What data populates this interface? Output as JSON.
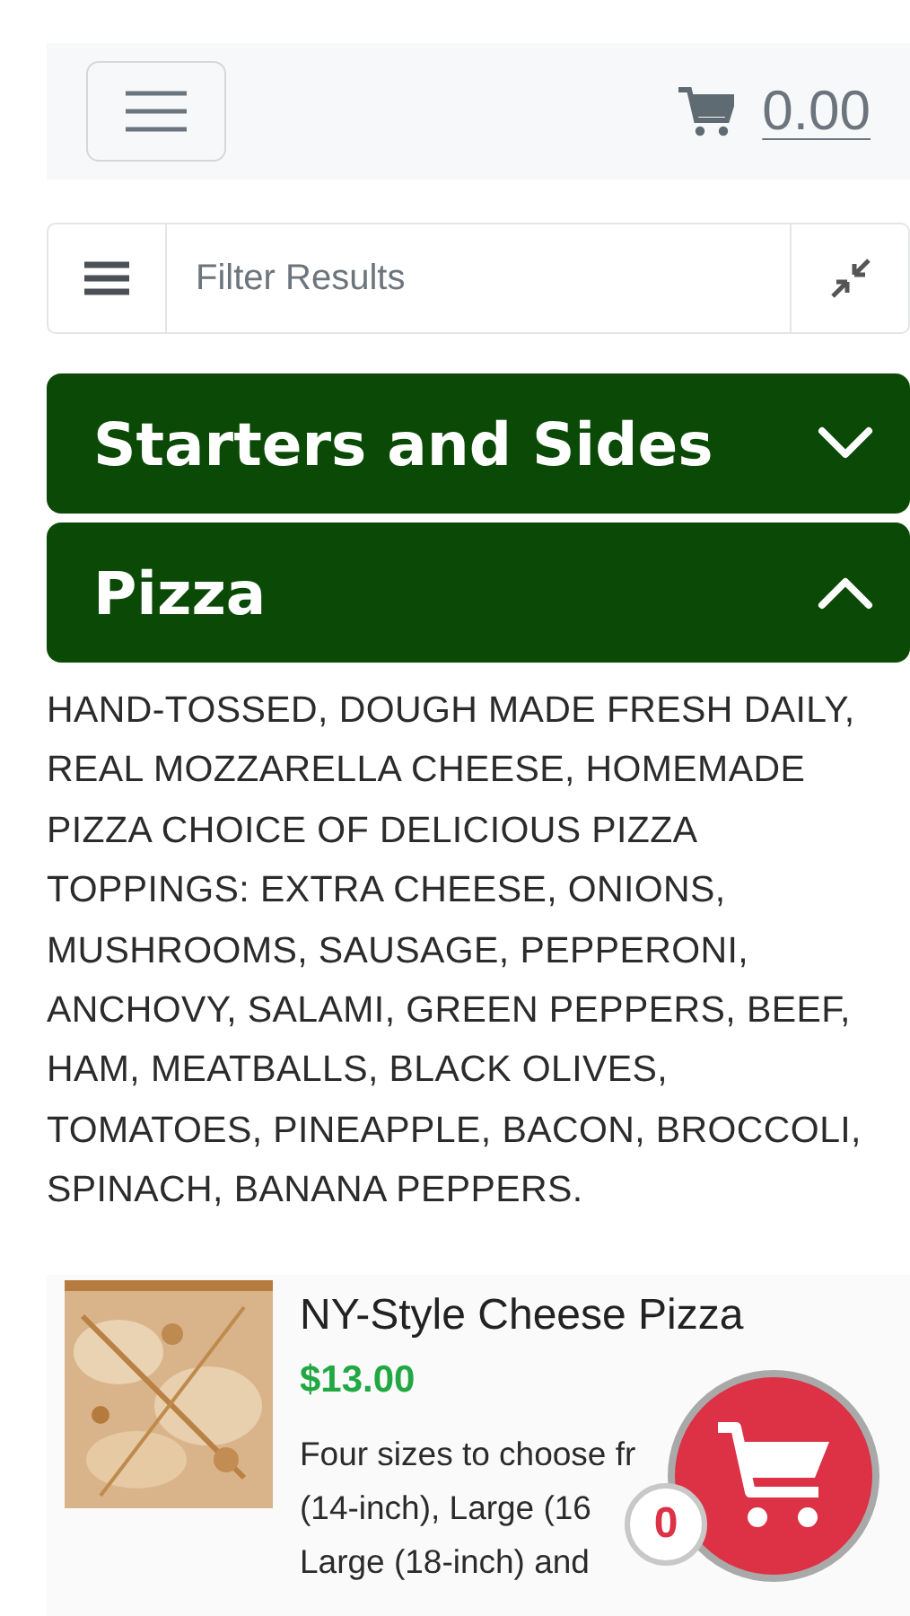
{
  "header": {
    "cart_total": "0.00"
  },
  "filter": {
    "placeholder": "Filter Results"
  },
  "categories": [
    {
      "title": "Starters and Sides",
      "expanded": false
    },
    {
      "title": "Pizza",
      "expanded": true,
      "description_lines": [
        "HAND-TOSSED, DOUGH MADE FRESH DAILY,",
        "REAL MOZZARELLA CHEESE, HOMEMADE",
        "PIZZA CHOICE OF DELICIOUS PIZZA",
        "TOPPINGS: EXTRA CHEESE, ONIONS,",
        "MUSHROOMS, SAUSAGE, PEPPERONI,",
        "ANCHOVY, SALAMI, GREEN PEPPERS, BEEF,",
        "HAM, MEATBALLS, BLACK OLIVES,",
        "TOMATOES, PINEAPPLE, BACON, BROCCOLI,",
        "SPINACH, BANANA PEPPERS."
      ],
      "items": [
        {
          "name": "NY-Style Cheese Pizza",
          "price": "$13.00",
          "description_lines": [
            "Four sizes to choose fr",
            "(14-inch), Large (16",
            "Large (18-inch) and"
          ]
        }
      ]
    }
  ],
  "cart_button": {
    "count": "0"
  }
}
